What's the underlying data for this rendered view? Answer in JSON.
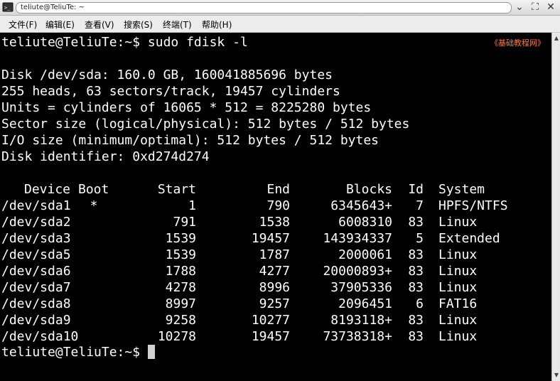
{
  "window": {
    "title": "teliute@TeliuTe: ~",
    "controls": [
      "chevron-down-icon",
      "maximize-icon",
      "close-icon"
    ]
  },
  "menu": [
    "文件(F)",
    "编辑(E)",
    "查看(V)",
    "搜索(S)",
    "终端(T)",
    "帮助(H)"
  ],
  "watermark": "《基础教程网》",
  "terminal": {
    "prompt_cmd": "teliute@TeliuTe:~$ sudo fdisk -l",
    "disk_info": [
      "Disk /dev/sda: 160.0 GB, 160041885696 bytes",
      "255 heads, 63 sectors/track, 19457 cylinders",
      "Units = cylinders of 16065 * 512 = 8225280 bytes",
      "Sector size (logical/physical): 512 bytes / 512 bytes",
      "I/O size (minimum/optimal): 512 bytes / 512 bytes",
      "Disk identifier: 0xd274d274"
    ],
    "table_headers": {
      "device": "Device",
      "boot": "Boot",
      "start": "Start",
      "end": "End",
      "blocks": "Blocks",
      "id": "Id",
      "system": "System"
    },
    "partitions": [
      {
        "device": "/dev/sda1",
        "boot": "*",
        "start": "1",
        "end": "790",
        "blocks": "6345643+",
        "id": "7",
        "system": "HPFS/NTFS"
      },
      {
        "device": "/dev/sda2",
        "boot": "",
        "start": "791",
        "end": "1538",
        "blocks": "6008310",
        "id": "83",
        "system": "Linux"
      },
      {
        "device": "/dev/sda3",
        "boot": "",
        "start": "1539",
        "end": "19457",
        "blocks": "143934337",
        "id": "5",
        "system": "Extended"
      },
      {
        "device": "/dev/sda5",
        "boot": "",
        "start": "1539",
        "end": "1787",
        "blocks": "2000061",
        "id": "83",
        "system": "Linux"
      },
      {
        "device": "/dev/sda6",
        "boot": "",
        "start": "1788",
        "end": "4277",
        "blocks": "20000893+",
        "id": "83",
        "system": "Linux"
      },
      {
        "device": "/dev/sda7",
        "boot": "",
        "start": "4278",
        "end": "8996",
        "blocks": "37905336",
        "id": "83",
        "system": "Linux"
      },
      {
        "device": "/dev/sda8",
        "boot": "",
        "start": "8997",
        "end": "9257",
        "blocks": "2096451",
        "id": "6",
        "system": "FAT16"
      },
      {
        "device": "/dev/sda9",
        "boot": "",
        "start": "9258",
        "end": "10277",
        "blocks": "8193118+",
        "id": "83",
        "system": "Linux"
      },
      {
        "device": "/dev/sda10",
        "boot": "",
        "start": "10278",
        "end": "19457",
        "blocks": "73738318+",
        "id": "83",
        "system": "Linux"
      }
    ],
    "final_prompt": "teliute@TeliuTe:~$ "
  }
}
